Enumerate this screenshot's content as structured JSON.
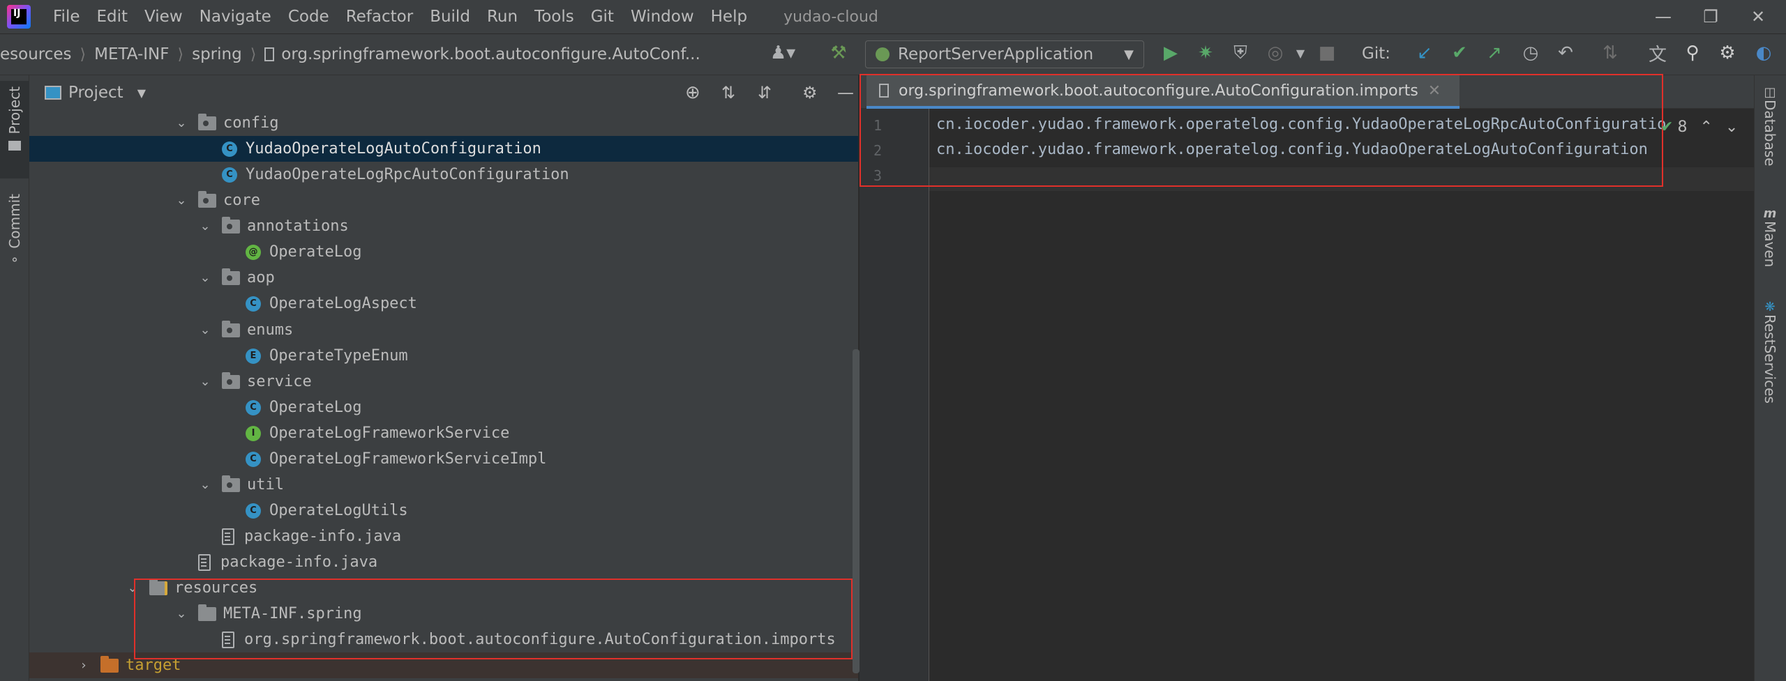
{
  "app_logo": "IJ",
  "menu": [
    "File",
    "Edit",
    "View",
    "Navigate",
    "Code",
    "Refactor",
    "Build",
    "Run",
    "Tools",
    "Git",
    "Window",
    "Help"
  ],
  "window_title": "yudao-cloud",
  "breadcrumbs": [
    "esources",
    "META-INF",
    "spring",
    "org.springframework.boot.autoconfigure.AutoConf..."
  ],
  "run_config": "ReportServerApplication",
  "git_label": "Git:",
  "left_tabs": {
    "project": "Project",
    "commit": "Commit"
  },
  "project_panel": {
    "title": "Project",
    "tree": [
      {
        "label": "config",
        "kind": "folder",
        "depth": 1,
        "expanded": true
      },
      {
        "label": "YudaoOperateLogAutoConfiguration",
        "kind": "class",
        "depth": 2,
        "selected": true
      },
      {
        "label": "YudaoOperateLogRpcAutoConfiguration",
        "kind": "class",
        "depth": 2
      },
      {
        "label": "core",
        "kind": "folder",
        "depth": 1,
        "expanded": true
      },
      {
        "label": "annotations",
        "kind": "folder",
        "depth": 2,
        "expanded": true
      },
      {
        "label": "OperateLog",
        "kind": "annotation",
        "depth": 3
      },
      {
        "label": "aop",
        "kind": "folder",
        "depth": 2,
        "expanded": true
      },
      {
        "label": "OperateLogAspect",
        "kind": "class",
        "depth": 3
      },
      {
        "label": "enums",
        "kind": "folder",
        "depth": 2,
        "expanded": true
      },
      {
        "label": "OperateTypeEnum",
        "kind": "enum",
        "depth": 3
      },
      {
        "label": "service",
        "kind": "folder",
        "depth": 2,
        "expanded": true
      },
      {
        "label": "OperateLog",
        "kind": "class",
        "depth": 3
      },
      {
        "label": "OperateLogFrameworkService",
        "kind": "interface",
        "depth": 3
      },
      {
        "label": "OperateLogFrameworkServiceImpl",
        "kind": "class",
        "depth": 3
      },
      {
        "label": "util",
        "kind": "folder",
        "depth": 2,
        "expanded": true
      },
      {
        "label": "OperateLogUtils",
        "kind": "class",
        "depth": 3
      },
      {
        "label": "package-info.java",
        "kind": "file",
        "depth": 2
      },
      {
        "label": "package-info.java",
        "kind": "file",
        "depth": 1
      },
      {
        "label": "resources",
        "kind": "resources",
        "depth": 0,
        "expanded": true
      },
      {
        "label": "META-INF.spring",
        "kind": "plainfolder",
        "depth": 1,
        "expanded": true
      },
      {
        "label": "org.springframework.boot.autoconfigure.AutoConfiguration.imports",
        "kind": "file",
        "depth": 2
      },
      {
        "label": "target",
        "kind": "target",
        "depth": -1,
        "expanded": false
      }
    ]
  },
  "editor": {
    "tab_label": "org.springframework.boot.autoconfigure.AutoConfiguration.imports",
    "line_numbers": [
      "1",
      "2",
      "3"
    ],
    "lines": [
      "cn.iocoder.yudao.framework.operatelog.config.YudaoOperateLogRpcAutoConfiguratio",
      "cn.iocoder.yudao.framework.operatelog.config.YudaoOperateLogAutoConfiguration",
      ""
    ],
    "inspection_count": "8"
  },
  "right_tabs": [
    "Database",
    "Maven",
    "RestServices"
  ],
  "colors": {
    "accent": "#4a88c7",
    "highlight_box": "#e0302a",
    "selected_row": "#0d293e"
  }
}
